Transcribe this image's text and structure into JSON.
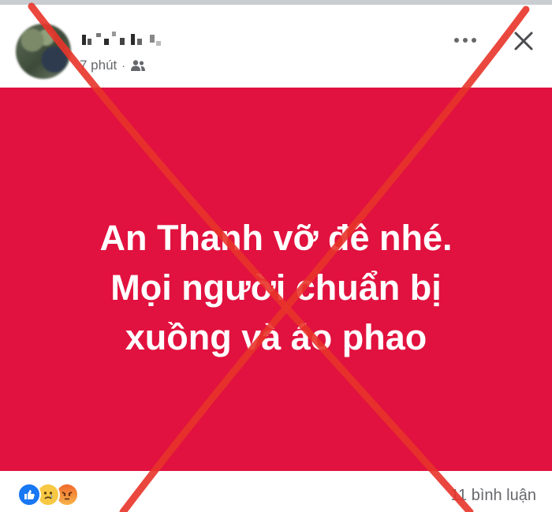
{
  "post": {
    "time_label": "7 phút",
    "separator": "·",
    "audience_icon": "friends-icon",
    "background_color": "#e1123f",
    "lines": [
      "An Thanh vỡ đê nhé.",
      "Mọi người chuẩn bị",
      "xuồng và áo phao"
    ]
  },
  "header": {
    "more_icon": "more-dots-icon",
    "close_icon": "close-icon"
  },
  "footer": {
    "reactions": [
      "like-reaction-icon",
      "sad-reaction-icon",
      "angry-reaction-icon"
    ],
    "comment_count_label": "11 bình luận"
  },
  "overlay": {
    "mark": "red-x-mark",
    "color": "#e8342a"
  }
}
